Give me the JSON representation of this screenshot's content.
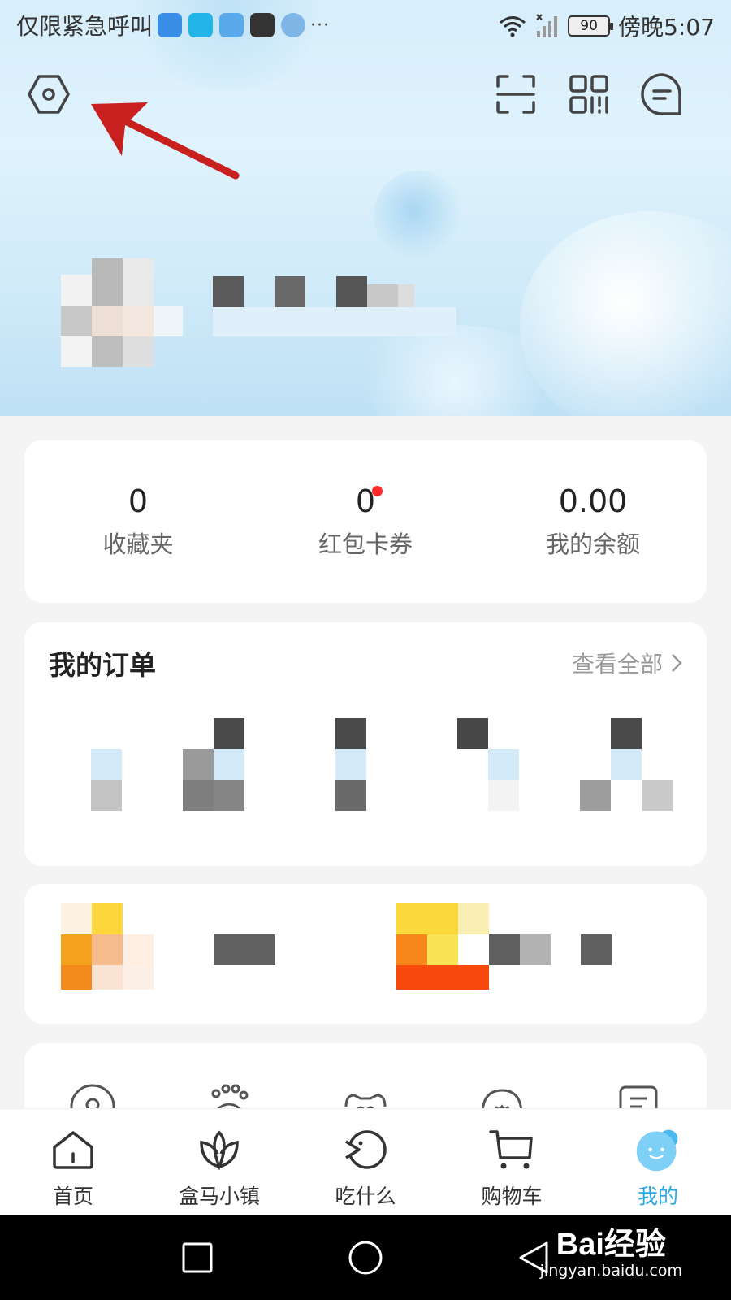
{
  "status_bar": {
    "carrier_text": "仅限紧急呼叫",
    "more_dots": "···",
    "battery": "90",
    "time": "傍晚5:07"
  },
  "header": {
    "settings_icon": "settings-hexagon-icon",
    "scan_icon": "scan-icon",
    "qrcode_icon": "qrcode-icon",
    "message_icon": "message-icon"
  },
  "stats": [
    {
      "value": "0",
      "label": "收藏夹"
    },
    {
      "value": "0",
      "label": "红包卡券"
    },
    {
      "value": "0.00",
      "label": "我的余额"
    }
  ],
  "orders": {
    "title": "我的订单",
    "view_all": "查看全部",
    "chevron": "›"
  },
  "tabs": [
    {
      "label": "首页",
      "icon": "home-icon"
    },
    {
      "label": "盒马小镇",
      "icon": "lotus-icon"
    },
    {
      "label": "吃什么",
      "icon": "fish-icon"
    },
    {
      "label": "购物车",
      "icon": "cart-icon"
    },
    {
      "label": "我的",
      "icon": "profile-face-icon"
    }
  ],
  "watermark": {
    "main": "Bai经验",
    "sub": "jingyan.baidu.com"
  },
  "colors": {
    "accent": "#2aa8e6",
    "red_dot": "#ff2a2a",
    "arrow": "#c8201e"
  }
}
